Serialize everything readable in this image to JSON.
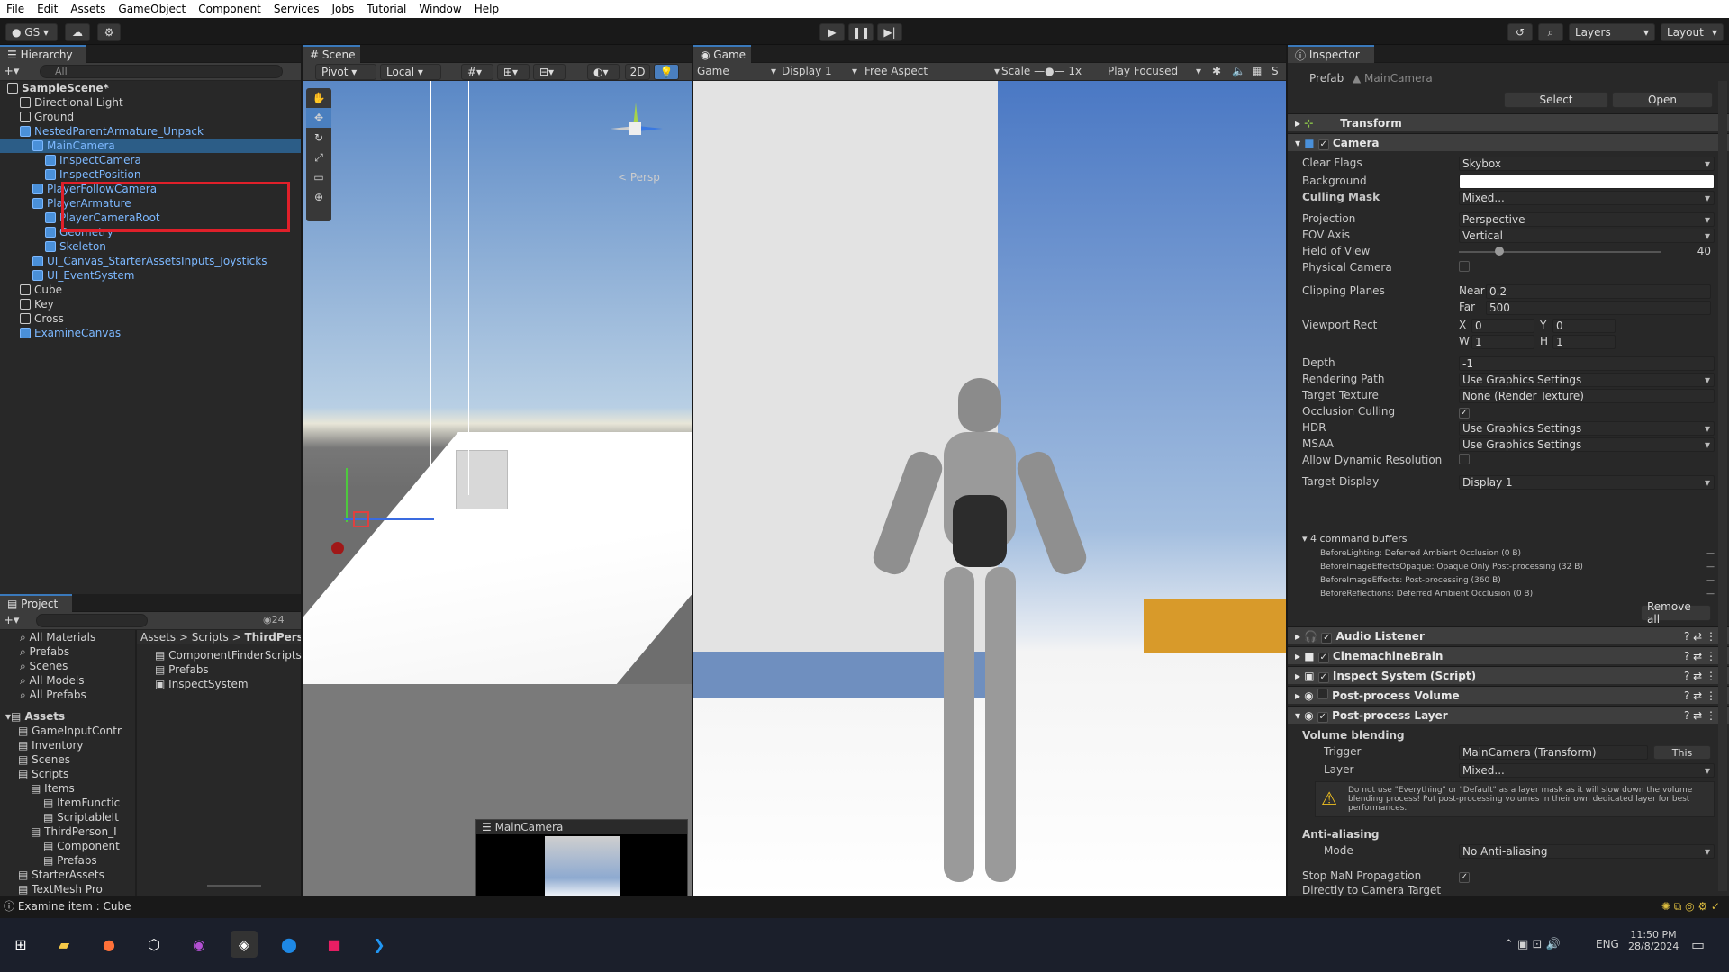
{
  "menu": [
    "File",
    "Edit",
    "Assets",
    "GameObject",
    "Component",
    "Services",
    "Jobs",
    "Tutorial",
    "Window",
    "Help"
  ],
  "toolbar": {
    "account": "GS",
    "layers": "Layers",
    "layout": "Layout"
  },
  "hierarchy": {
    "tab": "Hierarchy",
    "search": "All",
    "items": [
      {
        "label": "SampleScene*",
        "depth": 0,
        "bold": true,
        "blue": false
      },
      {
        "label": "Directional Light",
        "depth": 1,
        "blue": false
      },
      {
        "label": "Ground",
        "depth": 1,
        "blue": false
      },
      {
        "label": "NestedParentArmature_Unpack",
        "depth": 1,
        "blue": true
      },
      {
        "label": "MainCamera",
        "depth": 2,
        "blue": true
      },
      {
        "label": "InspectCamera",
        "depth": 3,
        "blue": true
      },
      {
        "label": "InspectPosition",
        "depth": 3,
        "blue": true
      },
      {
        "label": "PlayerFollowCamera",
        "depth": 2,
        "blue": true
      },
      {
        "label": "PlayerArmature",
        "depth": 2,
        "blue": true
      },
      {
        "label": "PlayerCameraRoot",
        "depth": 3,
        "blue": true
      },
      {
        "label": "Geometry",
        "depth": 3,
        "blue": true
      },
      {
        "label": "Skeleton",
        "depth": 3,
        "blue": true
      },
      {
        "label": "UI_Canvas_StarterAssetsInputs_Joysticks",
        "depth": 2,
        "blue": true
      },
      {
        "label": "UI_EventSystem",
        "depth": 2,
        "blue": true
      },
      {
        "label": "Cube",
        "depth": 1,
        "blue": false
      },
      {
        "label": "Key",
        "depth": 1,
        "blue": false
      },
      {
        "label": "Cross",
        "depth": 1,
        "blue": false
      },
      {
        "label": "ExamineCanvas",
        "depth": 1,
        "blue": true
      }
    ]
  },
  "scene": {
    "tab": "Scene",
    "pivot": "Pivot",
    "local": "Local",
    "mode2d": "2D",
    "persp": "< Persp",
    "camera_preview": "MainCamera"
  },
  "game": {
    "tab": "Game",
    "game": "Game",
    "display": "Display 1",
    "aspect": "Free Aspect",
    "scale_label": "Scale",
    "scale_value": "1x",
    "play_focused": "Play Focused"
  },
  "project": {
    "tab": "Project",
    "count": "24",
    "left_items": [
      "All Materials",
      "Prefabs",
      "Scenes",
      "All Models",
      "All Prefabs"
    ],
    "assets_label": "Assets",
    "tree": [
      "GameInputContr",
      "Inventory",
      "Scenes",
      "Scripts",
      "Items",
      "ItemFunctic",
      "ScriptableIt",
      "ThirdPerson_I",
      "Component",
      "Prefabs",
      "StarterAssets",
      "TextMesh Pro"
    ],
    "breadcrumb": [
      "Assets",
      "Scripts",
      "ThirdPerso"
    ],
    "files": [
      "ComponentFinderScripts",
      "Prefabs",
      "InspectSystem"
    ]
  },
  "inspector": {
    "tab": "Inspector",
    "prefab_label": "Prefab",
    "prefab_value": "MainCamera",
    "select": "Select",
    "open": "Open",
    "transform": "Transform",
    "camera": "Camera",
    "props": [
      {
        "k": "Clear Flags",
        "v": "Skybox"
      },
      {
        "k": "Background",
        "v": ""
      },
      {
        "k": "Culling Mask",
        "v": "Mixed..."
      },
      {
        "k": "Projection",
        "v": "Perspective"
      },
      {
        "k": "FOV Axis",
        "v": "Vertical"
      },
      {
        "k": "Field of View",
        "v": "40"
      },
      {
        "k": "Physical Camera",
        "v": ""
      },
      {
        "k": "Clipping Planes",
        "v": ""
      },
      {
        "k": "Viewport Rect",
        "v": ""
      },
      {
        "k": "Depth",
        "v": "-1"
      },
      {
        "k": "Rendering Path",
        "v": "Use Graphics Settings"
      },
      {
        "k": "Target Texture",
        "v": "None (Render Texture)"
      },
      {
        "k": "Occlusion Culling",
        "v": ""
      },
      {
        "k": "HDR",
        "v": "Use Graphics Settings"
      },
      {
        "k": "MSAA",
        "v": "Use Graphics Settings"
      },
      {
        "k": "Allow Dynamic Resolution",
        "v": ""
      },
      {
        "k": "Target Display",
        "v": "Display 1"
      }
    ],
    "near_label": "Near",
    "near": "0.2",
    "far_label": "Far",
    "far": "500",
    "x_label": "X",
    "x": "0",
    "y_label": "Y",
    "y": "0",
    "w_label": "W",
    "w": "1",
    "h_label": "H",
    "h": "1",
    "buffers_title": "4 command buffers",
    "buffers": [
      "BeforeLighting: Deferred Ambient Occlusion (0 B)",
      "BeforeImageEffectsOpaque: Opaque Only Post-processing (32 B)",
      "BeforeImageEffects: Post-processing (360 B)",
      "BeforeReflections: Deferred Ambient Occlusion (0 B)"
    ],
    "remove_all": "Remove all",
    "components": [
      "Audio Listener",
      "CinemachineBrain",
      "Inspect System (Script)",
      "Post-process Volume",
      "Post-process Layer"
    ],
    "volume_blending": "Volume blending",
    "trigger_label": "Trigger",
    "trigger_value": "MainCamera (Transform)",
    "this_btn": "This",
    "layer_label": "Layer",
    "layer_value": "Mixed...",
    "warning": "Do not use \"Everything\" or \"Default\" as a layer mask as it will slow down the volume blending process! Put post-processing volumes in their own dedicated layer for best performances.",
    "anti_aliasing": "Anti-aliasing",
    "mode_label": "Mode",
    "mode_value": "No Anti-aliasing",
    "stop_nan": "Stop NaN Propagation",
    "directly": "Directly to Camera Target"
  },
  "status": "Examine item : Cube",
  "taskbar": {
    "lang": "ENG",
    "time": "11:50 PM",
    "date": "28/8/2024"
  },
  "colors": {
    "accent": "#3a79bb",
    "highlight": "#e0202a",
    "prefab_blue": "#7cb8ff"
  }
}
